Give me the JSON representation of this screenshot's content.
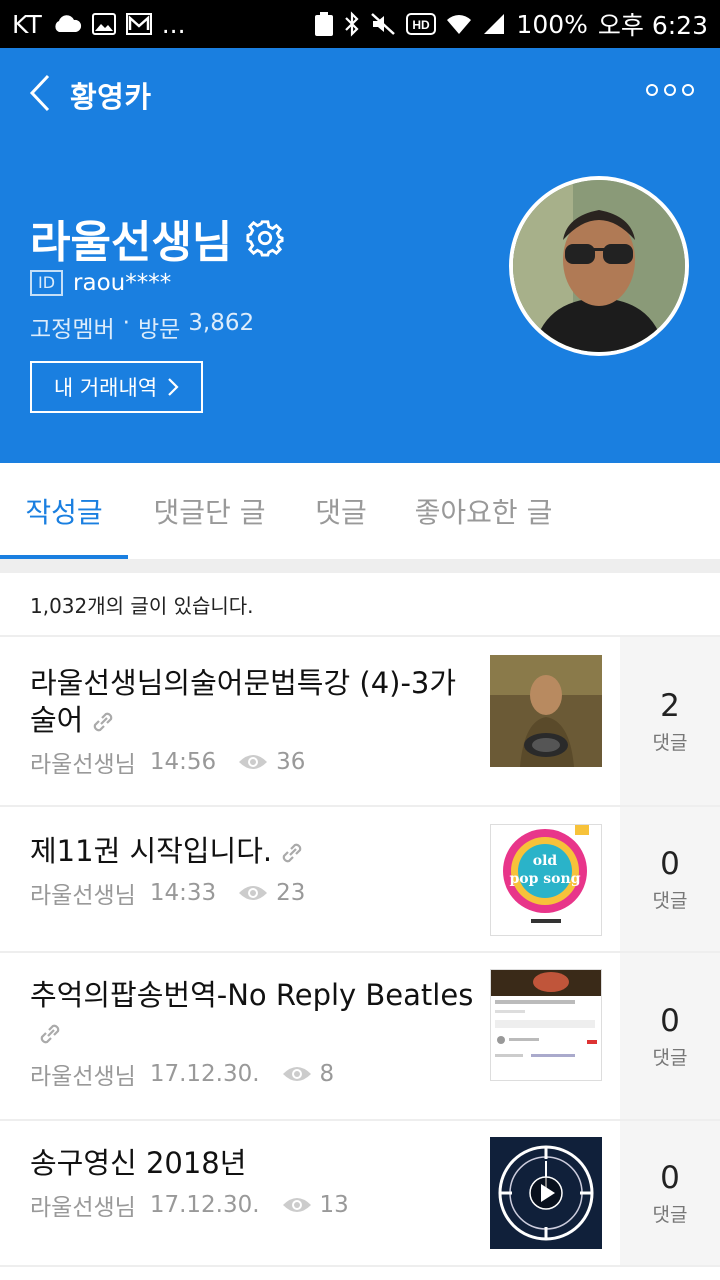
{
  "status_bar": {
    "carrier": "KT",
    "more": "...",
    "battery": "100%",
    "time": "오후 6:23"
  },
  "header": {
    "title": "황영카",
    "profile_name": "라울선생님",
    "id_badge": "ID",
    "user_id": "raou****",
    "member_level": "고정멤버",
    "separator": "·",
    "visits_label": "방문",
    "visits_count": "3,862",
    "trade_button": "내 거래내역"
  },
  "tabs": [
    {
      "label": "작성글",
      "active": true
    },
    {
      "label": "댓글단 글",
      "active": false
    },
    {
      "label": "댓글",
      "active": false
    },
    {
      "label": "좋아요한 글",
      "active": false
    }
  ],
  "post_count_text": "1,032개의 글이 있습니다.",
  "posts": [
    {
      "title": "라울선생님의술어문법특강 (4)-3가술어",
      "author": "라울선생님",
      "time": "14:56",
      "views": "36",
      "comments": "2",
      "comments_label": "댓글",
      "thumbnail_icon": "photo-man-icon"
    },
    {
      "title": "제11권 시작입니다.",
      "author": "라울선생님",
      "time": "14:33",
      "views": "23",
      "comments": "0",
      "comments_label": "댓글",
      "thumbnail_icon": "old-pop-song-cover-icon",
      "thumb_text": "old pop song"
    },
    {
      "title": "추억의팝송번역-No Reply Beatles",
      "author": "라울선생님",
      "time": "17.12.30.",
      "views": "8",
      "comments": "0",
      "comments_label": "댓글",
      "thumbnail_icon": "youtube-screenshot-icon"
    },
    {
      "title": "송구영신 2018년",
      "author": "라울선생님",
      "time": "17.12.30.",
      "views": "13",
      "comments": "0",
      "comments_label": "댓글",
      "thumbnail_icon": "clock-video-icon"
    }
  ],
  "colors": {
    "brand_blue": "#1a7fe0"
  }
}
